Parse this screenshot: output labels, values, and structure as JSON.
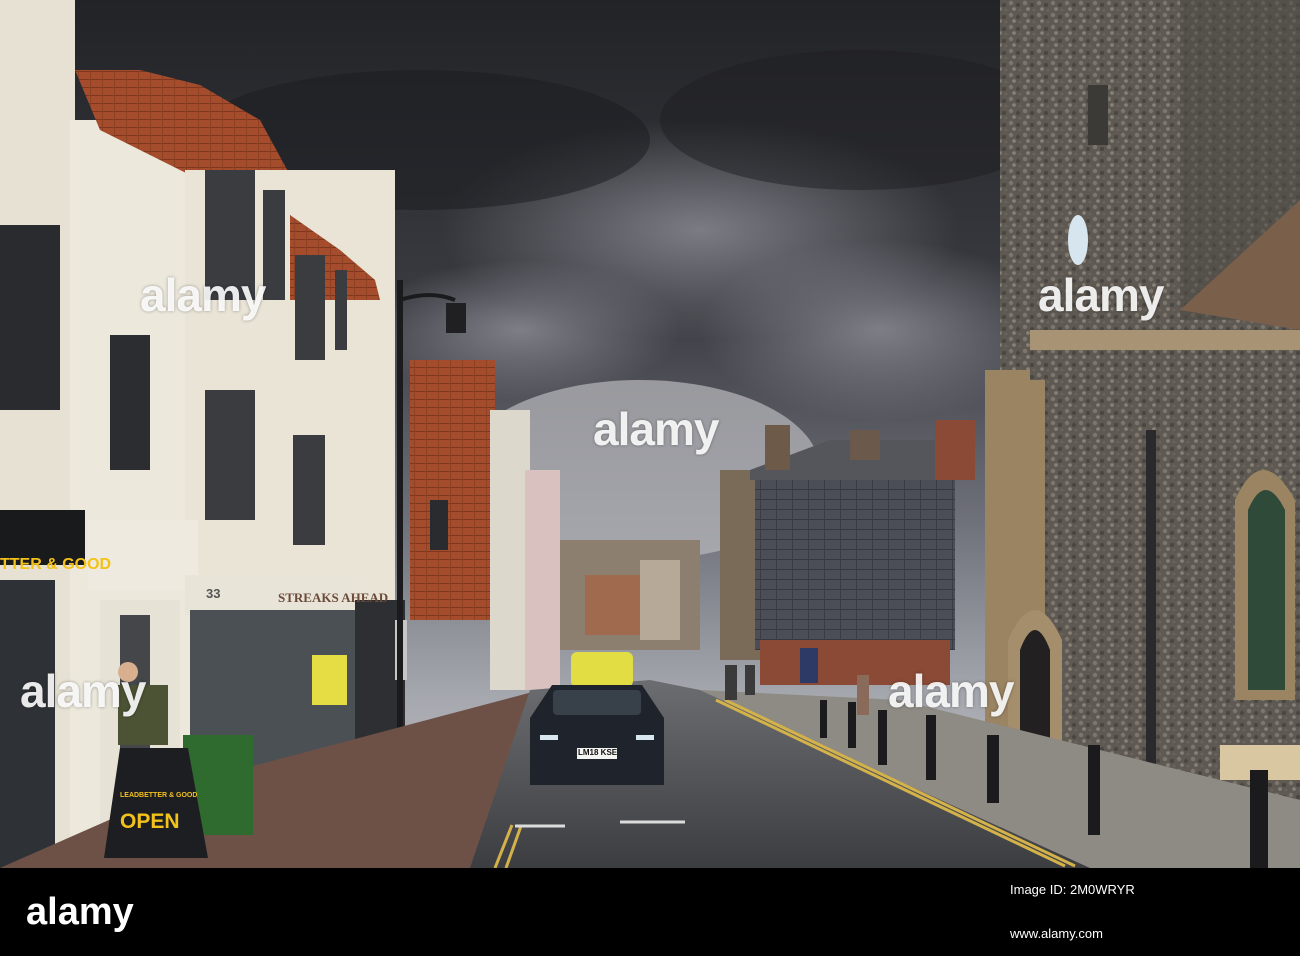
{
  "image": {
    "description_hidden": true,
    "colors": {
      "sky_dark": "#2b2b30",
      "sky_light": "#9a9ca3",
      "road": "#4a4b4f",
      "brick": "#a9502e",
      "flint": "#6e6860",
      "stone": "#a08a68",
      "cream": "#e8e3d6",
      "sign_yellow": "#f2c21b",
      "car_dark": "#1d2229",
      "taxi": "#e6e24a"
    }
  },
  "signs": {
    "shop_fascia": "TTER & GOOD",
    "shop_number": "33",
    "streaks_ahead": "STREAKS AHEAD",
    "aboard_brand": "LEADBETTER & GOOD",
    "aboard_open": "OPEN",
    "plate": "LM18 KSE"
  },
  "watermark": {
    "text": "alamy",
    "text_small": "a"
  },
  "footer": {
    "logo": "alamy",
    "image_id_label": "Image ID: 2M0WRYR",
    "url": "www.alamy.com"
  }
}
